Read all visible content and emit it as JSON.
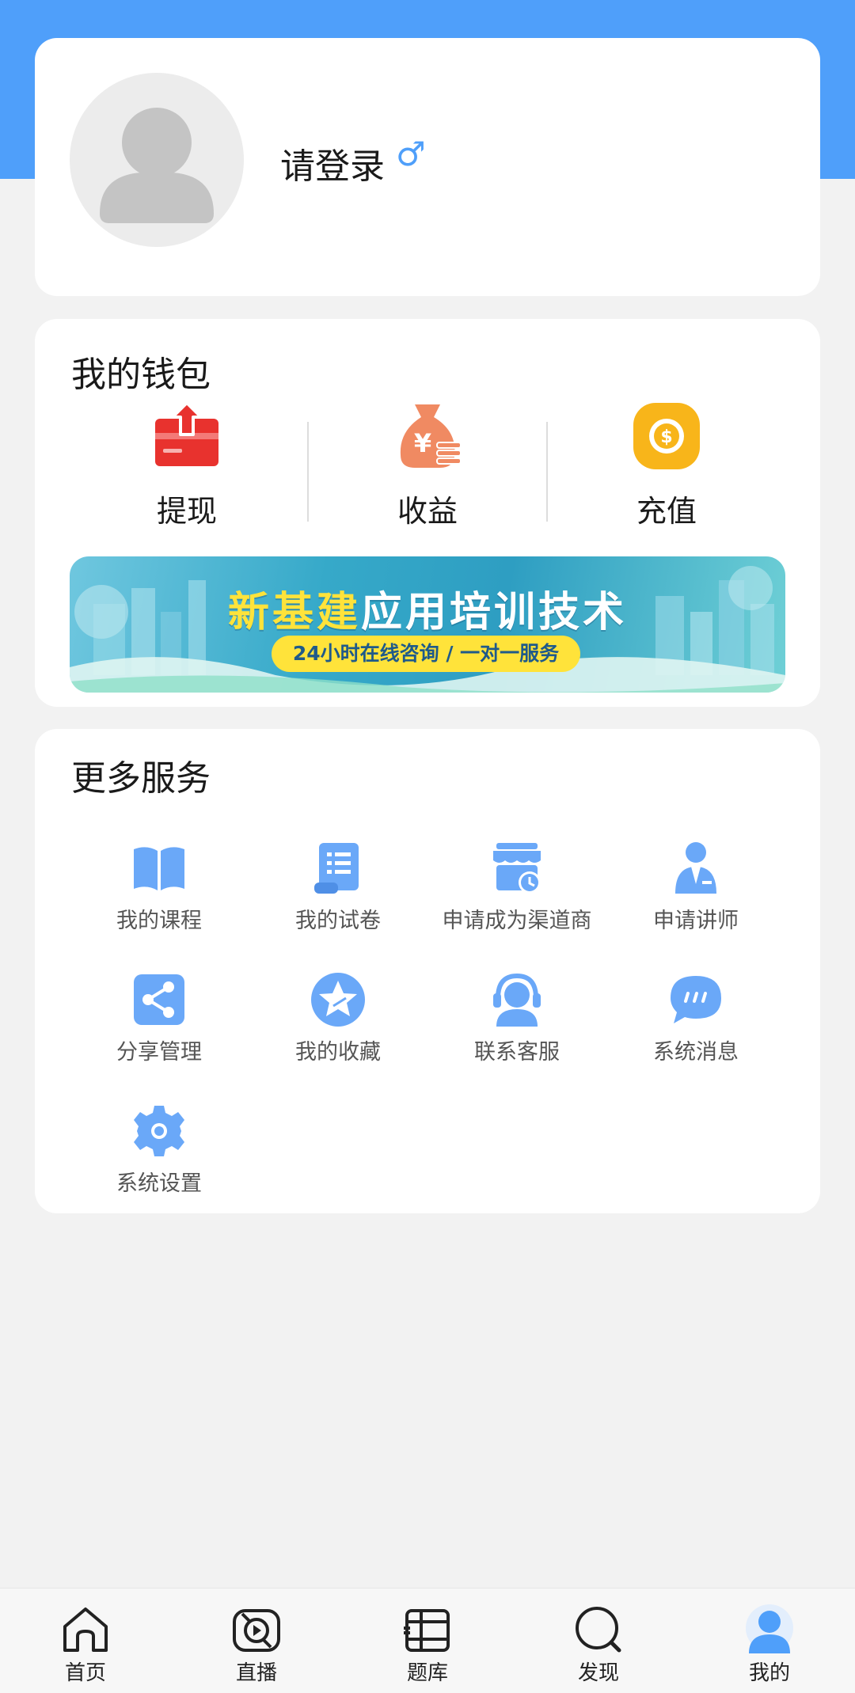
{
  "colors": {
    "accent": "#4f9ffa",
    "header_bg": "#4f9ffa",
    "page_bg": "#f2f2f2",
    "banner_highlight": "#ffe33a"
  },
  "profile": {
    "login_text": "请登录",
    "gender_symbol": "♂",
    "avatar_icon": "default-user-avatar"
  },
  "wallet": {
    "title": "我的钱包",
    "items": [
      {
        "label": "提现",
        "icon": "withdraw-icon"
      },
      {
        "label": "收益",
        "icon": "money-bag-icon"
      },
      {
        "label": "充值",
        "icon": "recharge-coin-icon"
      }
    ],
    "banner": {
      "title_part1": "新基建",
      "title_part2": "应用培训技术",
      "subtitle": "24小时在线咨询 / 一对一服务"
    }
  },
  "services": {
    "title": "更多服务",
    "items": [
      {
        "label": "我的课程",
        "icon": "book-icon"
      },
      {
        "label": "我的试卷",
        "icon": "exam-paper-icon"
      },
      {
        "label": "申请成为渠道商",
        "icon": "store-icon"
      },
      {
        "label": "申请讲师",
        "icon": "lecturer-icon"
      },
      {
        "label": "分享管理",
        "icon": "share-icon"
      },
      {
        "label": "我的收藏",
        "icon": "favorite-star-icon"
      },
      {
        "label": "联系客服",
        "icon": "customer-service-icon"
      },
      {
        "label": "系统消息",
        "icon": "message-icon"
      },
      {
        "label": "系统设置",
        "icon": "settings-gear-icon"
      }
    ]
  },
  "tabbar": {
    "items": [
      {
        "label": "首页",
        "icon": "home-icon"
      },
      {
        "label": "直播",
        "icon": "live-icon"
      },
      {
        "label": "题库",
        "icon": "question-bank-icon"
      },
      {
        "label": "发现",
        "icon": "discover-icon"
      },
      {
        "label": "我的",
        "icon": "mine-icon",
        "active": true
      }
    ]
  }
}
